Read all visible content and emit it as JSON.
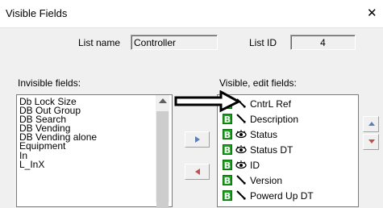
{
  "window": {
    "title": "Visible Fields",
    "close_glyph": "✕"
  },
  "list_name": {
    "label": "List name",
    "value": "Controller"
  },
  "list_id": {
    "label": "List ID",
    "value": "4"
  },
  "invisible": {
    "label": "Invisible fields:",
    "items": [
      "Db Lock Size",
      "DB Out Group",
      "DB Search",
      "DB Vending",
      "DB Vending alone",
      "Equipment",
      "In",
      "L_InX"
    ]
  },
  "visible": {
    "label": "Visible, edit fields:",
    "badge": "B",
    "items": [
      {
        "label": "CntrL Ref",
        "icon": "pencil-icon"
      },
      {
        "label": "Description",
        "icon": "pencil-icon"
      },
      {
        "label": "Status",
        "icon": "eye-icon"
      },
      {
        "label": "Status DT",
        "icon": "eye-icon"
      },
      {
        "label": "ID",
        "icon": "eye-icon"
      },
      {
        "label": "Version",
        "icon": "pencil-icon"
      },
      {
        "label": "Powerd Up DT",
        "icon": "pencil-icon"
      }
    ]
  },
  "colors": {
    "badge": "#17a31b",
    "arrow_blue": "#5b7fb5",
    "arrow_red": "#c0504d"
  }
}
